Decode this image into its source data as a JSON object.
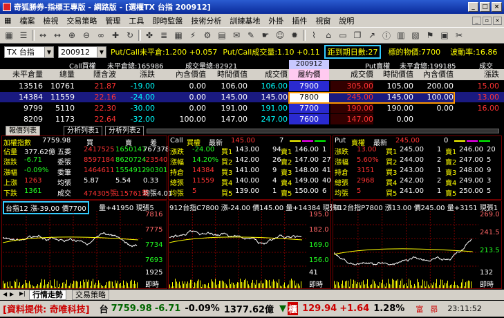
{
  "window": {
    "title": "奇狐勝券-指標王專版 - 網路版 - [選權TX 台指 200912]"
  },
  "menu": [
    "檔案",
    "檢視",
    "交易策略",
    "管理",
    "工具",
    "即時監盤",
    "技術分析",
    "訓練基地",
    "外掛",
    "插件",
    "視窗",
    "說明"
  ],
  "toolbar_icons": [
    "grid-icon",
    "menu-icon",
    "arrow-icon",
    "arrow-icon",
    "zoom-in-icon",
    "zoom-out-icon",
    "glasses-icon",
    "pin-icon",
    "refresh-icon",
    "puzzle-icon",
    "list-icon",
    "grid-icon",
    "plug-icon",
    "gear-icon",
    "chart-icon",
    "chat-icon",
    "pen-icon",
    "hand-icon",
    "user-icon",
    "fire-icon",
    "draw-icon",
    "tag-icon",
    "folder-icon",
    "copy-icon",
    "graph-icon",
    "info-icon",
    "book-icon",
    "calc-icon",
    "flag-icon",
    "box-icon",
    "scissors-icon"
  ],
  "info": {
    "symbol": "TX 台指",
    "month": "200912",
    "pc_oi": "Put/Call未平倉:1.200 +0.057",
    "pc_vol": "Put/Call成交量:1.10 +0.11",
    "days_to_expiry": "距到期日數:27",
    "underlying": "標的物價:7700",
    "volatility": "波動率:16.86"
  },
  "section": {
    "call_label": "Call買權",
    "call_oi": "未平倉總:165986",
    "call_vol": "成交量總:82921",
    "month": "200912",
    "put_label": "Put賣權",
    "put_oi": "未平倉總:199185",
    "put_vol": "成交"
  },
  "columns": [
    "未平倉量",
    "總量",
    "隱含波",
    "漲跌",
    "內含價值",
    "時間價值",
    "成交價",
    "履約價",
    "成交價",
    "時間價值",
    "內含價值",
    "漲跌"
  ],
  "rows": [
    [
      "13516",
      "10761",
      "21.87",
      "-19.00",
      "0.00",
      "106.00",
      "106.00",
      "7900",
      "305.00",
      "105.00",
      "200.00",
      "15.00"
    ],
    [
      "14384",
      "11559",
      "22.16",
      "-24.00",
      "0.00",
      "145.00",
      "145.00",
      "7800",
      "245.00",
      "145.00",
      "100.00",
      "13.00"
    ],
    [
      "9799",
      "5110",
      "22.30",
      "-30.00",
      "0.00",
      "191.00",
      "191.00",
      "7700",
      "190.00",
      "190.00",
      "0.00",
      "16.00"
    ],
    [
      "8209",
      "1173",
      "22.64",
      "-32.00",
      "100.00",
      "147.00",
      "247.00",
      "7600",
      "147.00",
      "0.00",
      "",
      ""
    ]
  ],
  "tabs1": [
    "報價列表",
    "分析列表1",
    "分析列表2"
  ],
  "summary": {
    "title": "加權指數",
    "value": "7759.98",
    "buy": "買",
    "sell": "賣",
    "diff": "差",
    "lines": [
      [
        "佔量",
        "377.62億",
        "五委",
        "2417525",
        "1650147",
        "767378"
      ],
      [
        "漲跌",
        "-6.71",
        "委張",
        "8597184",
        "8620724",
        "-23540"
      ],
      [
        "漲幅",
        "-0.09%",
        "委筆",
        "1464611",
        "1554912",
        "-90301"
      ],
      [
        "上漲",
        "1263",
        "均張",
        "5.87",
        "5.54",
        "0.33"
      ],
      [
        "下跌",
        "1361",
        "成交",
        "474305張",
        "115761筆",
        "均張4.01"
      ]
    ]
  },
  "call_quote": {
    "header": [
      "Call",
      "買權",
      "最新",
      "145.00",
      "7"
    ],
    "lines": [
      [
        "漲跌",
        "-24.00",
        "買1",
        "143.00",
        "94",
        "賣1",
        "146.00",
        "1"
      ],
      [
        "漲幅",
        "14.20%",
        "買2",
        "142.00",
        "26",
        "賣2",
        "147.00",
        "27"
      ],
      [
        "持倉",
        "14384",
        "買3",
        "141.00",
        "9",
        "賣3",
        "148.00",
        "41"
      ],
      [
        "總張",
        "11559",
        "買4",
        "140.00",
        "4",
        "賣4",
        "149.00",
        "40"
      ],
      [
        "均張",
        "5",
        "買5",
        "139.00",
        "1",
        "賣5",
        "150.00",
        "6"
      ]
    ]
  },
  "put_quote": {
    "header": [
      "Put",
      "賣權",
      "最新",
      "245.00",
      "0"
    ],
    "lines": [
      [
        "漲跌",
        "13.00",
        "買1",
        "245.00",
        "1",
        "賣1",
        "246.00",
        "20"
      ],
      [
        "漲幅",
        "5.60%",
        "買2",
        "244.00",
        "2",
        "賣2",
        "247.00",
        "5"
      ],
      [
        "持倉",
        "3151",
        "買3",
        "243.00",
        "1",
        "賣3",
        "248.00",
        "9"
      ],
      [
        "總張",
        "2968",
        "買4",
        "242.00",
        "2",
        "賣4",
        "249.00",
        "3"
      ],
      [
        "均張",
        "5",
        "買5",
        "241.00",
        "1",
        "賣5",
        "250.00",
        "5"
      ]
    ]
  },
  "charts": [
    {
      "title": "台指12 漲-39.00 價7700",
      "extra": "量+41950 現張5",
      "ticks": [
        "7816",
        "7775",
        "7734",
        "7693",
        "1925",
        "即時"
      ]
    },
    {
      "title": "912台指C7800 漲-24.00 價145.00 量+14384 現張1",
      "ticks": [
        "195.0",
        "182.0",
        "169.0",
        "156.0",
        "41",
        "即時"
      ]
    },
    {
      "title": "912台指P7800 漲13.00 價245.00 量+3151 現張1",
      "ticks": [
        "269.0",
        "241.5",
        "213.5",
        "132",
        "即時"
      ]
    }
  ],
  "tabs2": [
    "行情走勢",
    "交易策略"
  ],
  "status": {
    "provider": "[資料提供: 奇唯科技]",
    "tai": "台",
    "idx": "7759.98",
    "chg": "-6.71",
    "pct": "-0.09%",
    "amt": "1377.62億",
    "arrow": "▼",
    "cnt": "櫃",
    "otc": "129.94",
    "otcchg": "+1.64",
    "otcpct": "1.28%",
    "rich": "富",
    "pin": "昴",
    "time": "23:11:52"
  }
}
